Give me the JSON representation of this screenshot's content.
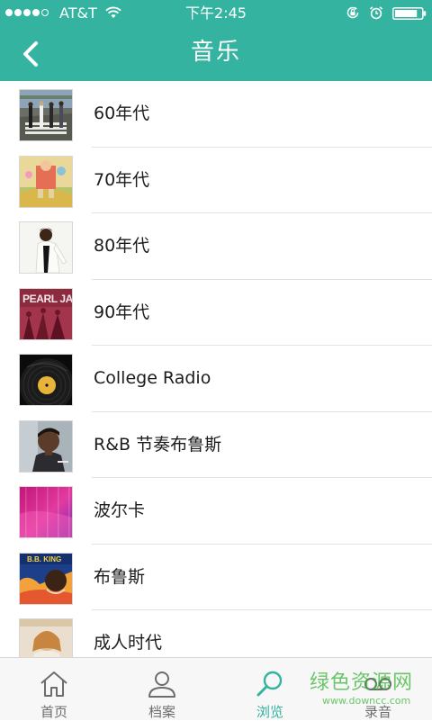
{
  "status_bar": {
    "carrier": "AT&T",
    "time": "下午2:45",
    "signal_bars": 4,
    "signal_total": 5,
    "icons": [
      "wifi-icon",
      "rotation-lock-icon",
      "alarm-icon",
      "battery-icon"
    ],
    "battery_level": 0.85
  },
  "nav": {
    "title": "音乐",
    "back_icon": "chevron-left-icon"
  },
  "list": {
    "items": [
      {
        "label": "60年代",
        "art": "abbey-road"
      },
      {
        "label": "70年代",
        "art": "yellow-brick-road"
      },
      {
        "label": "80年代",
        "art": "thriller"
      },
      {
        "label": "90年代",
        "art": "pearl-jam-ten"
      },
      {
        "label": "College Radio",
        "art": "vinyl-record"
      },
      {
        "label": "R&B 节奏布鲁斯",
        "art": "rnb-portrait"
      },
      {
        "label": "波尔卡",
        "art": "pink-abstract"
      },
      {
        "label": "布鲁斯",
        "art": "bb-king"
      },
      {
        "label": "成人时代",
        "art": "adult-contemporary"
      }
    ]
  },
  "tab_bar": {
    "active_index": 2,
    "tabs": [
      {
        "label": "首页",
        "icon": "home-icon"
      },
      {
        "label": "档案",
        "icon": "profile-icon"
      },
      {
        "label": "浏览",
        "icon": "search-icon"
      },
      {
        "label": "录音",
        "icon": "voicemail-icon"
      }
    ]
  },
  "watermark": {
    "text": "绿色资源网",
    "url": "www.downcc.com"
  },
  "colors": {
    "accent": "#34b3a0",
    "tab_inactive": "#6d6d6d",
    "divider": "#e3e3e3",
    "watermark": "#3bb53b"
  }
}
